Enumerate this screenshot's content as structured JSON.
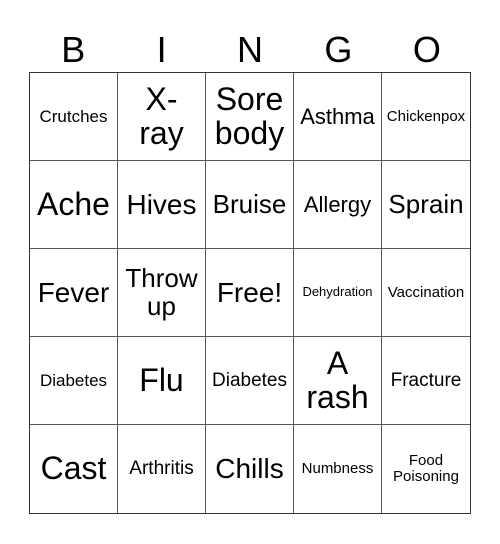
{
  "header": [
    "B",
    "I",
    "N",
    "G",
    "O"
  ],
  "cells": [
    {
      "text": "Crutches",
      "size": "s17"
    },
    {
      "text": "X-\nray",
      "size": "s32"
    },
    {
      "text": "Sore\nbody",
      "size": "s32"
    },
    {
      "text": "Asthma",
      "size": "s22"
    },
    {
      "text": "Chickenpox",
      "size": "s15"
    },
    {
      "text": "Ache",
      "size": "s32"
    },
    {
      "text": "Hives",
      "size": "s28"
    },
    {
      "text": "Bruise",
      "size": "s26"
    },
    {
      "text": "Allergy",
      "size": "s22"
    },
    {
      "text": "Sprain",
      "size": "s26"
    },
    {
      "text": "Fever",
      "size": "s28"
    },
    {
      "text": "Throw\nup",
      "size": "s26"
    },
    {
      "text": "Free!",
      "size": "s28"
    },
    {
      "text": "Dehydration",
      "size": "s13"
    },
    {
      "text": "Vaccination",
      "size": "s15"
    },
    {
      "text": "Diabetes",
      "size": "s17"
    },
    {
      "text": "Flu",
      "size": "s32"
    },
    {
      "text": "Diabetes",
      "size": "s19"
    },
    {
      "text": "A\nrash",
      "size": "s32"
    },
    {
      "text": "Fracture",
      "size": "s19"
    },
    {
      "text": "Cast",
      "size": "s32"
    },
    {
      "text": "Arthritis",
      "size": "s19"
    },
    {
      "text": "Chills",
      "size": "s28"
    },
    {
      "text": "Numbness",
      "size": "s15"
    },
    {
      "text": "Food\nPoisoning",
      "size": "s15"
    }
  ]
}
